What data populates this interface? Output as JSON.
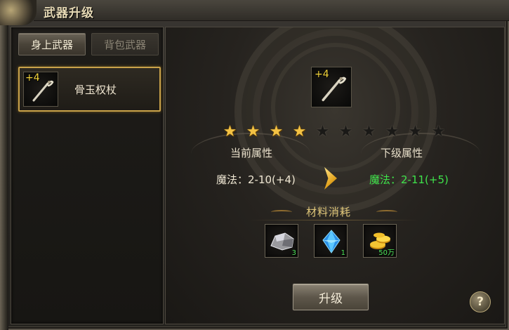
{
  "window": {
    "title": "武器升级"
  },
  "tabs": [
    {
      "label": "身上武器",
      "active": true
    },
    {
      "label": "背包武器",
      "active": false
    }
  ],
  "weapon_list": [
    {
      "name": "骨玉权杖",
      "plus": "+4",
      "selected": true,
      "icon": "staff-icon"
    }
  ],
  "preview": {
    "plus": "+4",
    "icon": "staff-icon"
  },
  "stars": {
    "filled": 4,
    "total": 10,
    "color_on": "#f3c244",
    "color_off": "#1a1917"
  },
  "attributes": {
    "current_heading": "当前属性",
    "next_heading": "下级属性",
    "current_value": "魔法：2-10(+4)",
    "next_value": "魔法：2-11(+5)",
    "next_color": "#3fe34b"
  },
  "materials": {
    "title": "材料消耗",
    "items": [
      {
        "icon": "ore-icon",
        "count": "3"
      },
      {
        "icon": "blue-crystal-icon",
        "count": "1"
      },
      {
        "icon": "gold-coins-icon",
        "count": "50万"
      }
    ]
  },
  "buttons": {
    "upgrade_label": "升级",
    "help_label": "?"
  }
}
